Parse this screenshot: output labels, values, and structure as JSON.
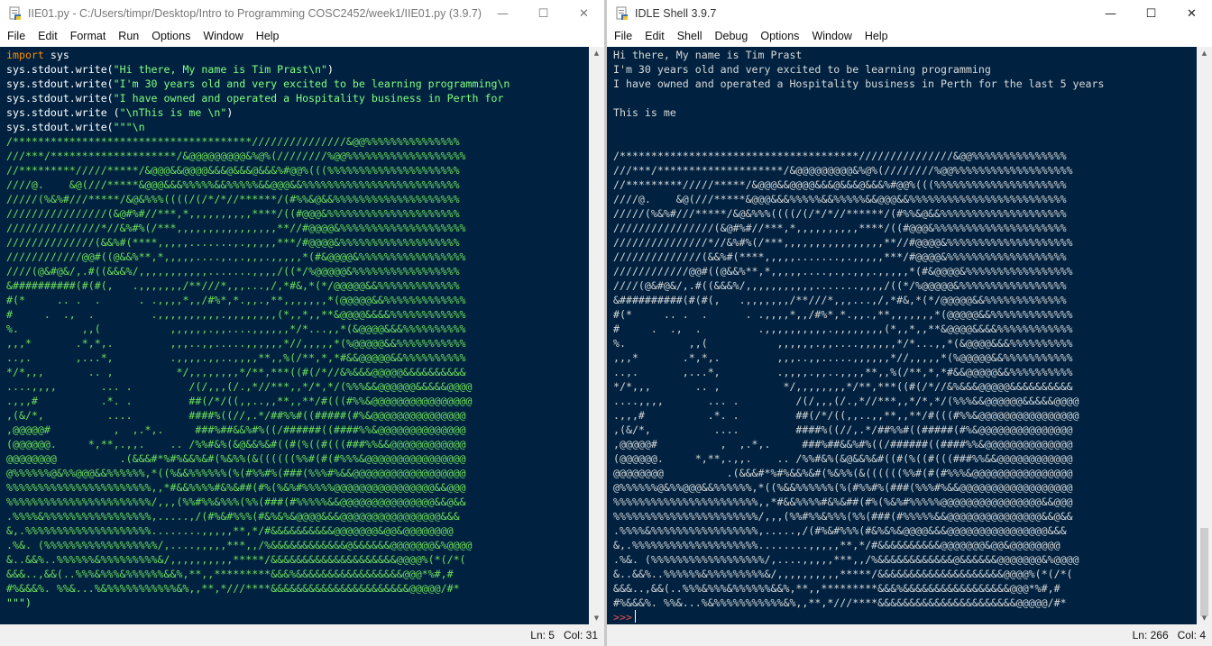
{
  "editor": {
    "title": "IIE01.py - C:/Users/timpr/Desktop/Intro to Programming COSC2452/week1/IIE01.py (3.9.7)",
    "menu": [
      "File",
      "Edit",
      "Format",
      "Run",
      "Options",
      "Window",
      "Help"
    ],
    "code": [
      {
        "kw": "import",
        "rest": " sys"
      },
      {
        "plain": "sys.stdout.write(",
        "str": "\"Hi there, My name is Tim Prast\\n\"",
        "end": ")"
      },
      {
        "plain": "sys.stdout.write(",
        "str": "\"I'm 30 years old and very excited to be learning programming\\n",
        "end": ""
      },
      {
        "plain": "sys.stdout.write(",
        "str": "\"I have owned and operated a Hospitality business in Perth for",
        "end": ""
      },
      {
        "plain": "sys.stdout.write (",
        "str": "\"\\nThis is me \\n\"",
        "end": ")"
      },
      {
        "plain": "sys.stdout.write(",
        "str": "\"\"\"\\n",
        "end": ""
      }
    ],
    "art": [
      "/**************************************///////////////&@@%%%%%%%%%%%%%%%",
      "///***/********************/&@@@@@@@@@&%@%(////////%@@%%%%%%%%%%%%%%%%%%%",
      "//*********/////*****/&@@@&&@@@@&&&@&&&@&&&%#@@%(((%%%%%%%%%%%%%%%%%%%%%",
      "////@.    &@(///*****&@@@&&&%%%%%&&%%%%%&&@@@&&%%%%%%%%%%%%%%%%%%%%%%%%%",
      "/////(%&%#///*****/&@&%%%((((/(/*/*//******/(#%%&@&&%%%%%%%%%%%%%%%%%%%%",
      "////////////////(&@#%#//***,*,,,,,,,,,,****/((#@@@&%%%%%%%%%%%%%%%%%%%%%",
      "///////////////*//&%#%(/***,,,,,,,,,,,,,,,,**//#@@@@&%%%%%%%%%%%%%%%%%%%%",
      "//////////////(&&%#(****,,,,,.......,.,,,,,***/#@@@@&%%%%%%%%%%%%%%%%%%%",
      "////////////@@#((@&&%**,*,,,,,....,.,.,,,.,,,,,*(#&@@@@&%%%%%%%%%%%%%%%%%",
      "////(@&#@&/,.#((&&&%/,,,,,,,,,,,.......,,,,/((*/%@@@@@&%%%%%%%%%%%%%%%%%",
      "&##########(#(#(,   .,,,,,,,/**///*,,,...,/,*#&,*(*/@@@@@&&%%%%%%%%%%%%%",
      "#(*     .. .  .      . .,,,,*,,/#%*,*.,,.,**,,,,,,,*(@@@@@&&%%%%%%%%%%%%%",
      "#     .  .,  .         .,,,,,,,,,,.,,,,,,,,(*,,*,,**&@@@@&&&&%%%%%%%%%%%%",
      "%.          ,,(           ,,,,,,.,,....,,,,,,*/*...,,*(&@@@@&&&%%%%%%%%%%",
      ",,,*       .*,*,.         ,,,..,,.....,,,,,,*//,,,,,*(%@@@@@&&%%%%%%%%%%%",
      "..,.       ,...*,         .,,,,.,,..,,,,**,,%(/**,*,*#&&@@@@@&&%%%%%%%%%%",
      "*/*,,,       .. ,          */,,,,,,,,*/**,***((#(/*//&%&&&@@@@@&&&&&&&&&&",
      "....,,,,       ... .         /(/,,,(/.,*//***,,*/*,*/(%%%&&@@@@@@&&&&&@@@@",
      ".,,,#          .*. .         ##(/*/((,,..,,**,,**/#(((#%%&@@@@@@@@@@@@@@@@",
      ",(&/*,          ....         ####%((//,.*/##%%#((#####(#%&@@@@@@@@@@@@@@@",
      ",@@@@@#          ,  ,.*,.     ###%##&&%#%((/######((####%%&@@@@@@@@@@@@@@",
      "(@@@@@@.     *,**,.,,.    .. /%%#&%(&@&&%&#((#(%((#(((###%%&&@@@@@@@@@@@@",
      "@@@@@@@@          .(&&&#*%#%&&%&#(%&%%(&((((((%%#(#(#%%%&@@@@@@@@@@@@@@@@",
      "@%%%%%%@&%%@@@&&%%%%%%,*((%&&%%%%%%(%(#%%#%(###(%%%#%&&@@@@@@@@@@@@@@@@@@",
      "%%%%%%%%%%%%%%%%%%%%%%%,,*#&&%%%%#&%&##(#%(%&%#%%%%%@@@@@@@@@@@@@@@@&&@@@",
      "%%%%%%%%%%%%%%%%%%%%%%%/,,,(%%#%%&%%%(%%(###(#%%%%%&&@@@@@@@@@@@@@@@&&@&&",
      ".%%%%&%%%%%%%%%%%%%%%%%,.....,/(#%&#%%%(#&%&%&@@@@&&&@@@@@@@@@@@@@@@@&&&",
      "&,.%%%%%%%%%%%%%%%%%%%%........,,,,,**,*/#&&&&&&&&&&@@@@@@@&@@&@@@@@@@@",
      ".%&. (%%%%%%%%%%%%%%%%%%/,....,,,,,***,,/%&&&&&&&&&&&&@&&&&&&@@@@@@@&%@@@@",
      "&..&&%..%%%%%%&%%%%%%%%%&/,,,,,,,,,,*****/&&&&&&&&&&&&&&&&&&&&@@@@%(*(/*(",
      "&&&..,&&(..%%%&%%%&%%%%%%&&%,**,,*********&&&%&&&&&&&&&&&&&&&&&@@@*%#,#",
      "#%&&&%. %%&...%&%%%%%%%%%%%&%,,**,*///****&&&&&&&&&&&&&&&&&&&&&&@@@@@/#*"
    ],
    "closing": "\"\"\")",
    "status": {
      "ln": "Ln: 5",
      "col": "Col: 31"
    }
  },
  "shell": {
    "title": "IDLE Shell 3.9.7",
    "menu": [
      "File",
      "Edit",
      "Shell",
      "Debug",
      "Options",
      "Window",
      "Help"
    ],
    "output": [
      "Hi there, My name is Tim Prast",
      "I'm 30 years old and very excited to be learning programming",
      "I have owned and operated a Hospitality business in Perth for the last 5 years",
      "",
      "This is me",
      "",
      ""
    ],
    "art": [
      "/**************************************///////////////&@@%%%%%%%%%%%%%%%",
      "///***/********************/&@@@@@@@@@&%@%(////////%@@%%%%%%%%%%%%%%%%%%%",
      "//*********/////*****/&@@@&&@@@@&&&@&&&@&&&%#@@%(((%%%%%%%%%%%%%%%%%%%%%",
      "////@.    &@(///*****&@@@&&&%%%%%&&%%%%%&&@@@&&%%%%%%%%%%%%%%%%%%%%%%%%%",
      "/////(%&%#///*****/&@&%%%((((/(/*/*//******/(#%%&@&&%%%%%%%%%%%%%%%%%%%%",
      "////////////////(&@#%#//***,*,,,,,,,,,,****/((#@@@&%%%%%%%%%%%%%%%%%%%%%",
      "///////////////*//&%#%(/***,,,,,,,,,,,,,,,,**//#@@@@&%%%%%%%%%%%%%%%%%%%%",
      "//////////////(&&%#(****,,,,,.......,.,,,,,***/#@@@@&%%%%%%%%%%%%%%%%%%%",
      "////////////@@#((@&&%**,*,,,,,....,.,.,,,.,,,,,*(#&@@@@&%%%%%%%%%%%%%%%%%",
      "////(@&#@&/,.#((&&&%/,,,,,,,,,,,.......,,,,/((*/%@@@@@&%%%%%%%%%%%%%%%%%",
      "&##########(#(#(,   .,,,,,,,/**///*,,,...,/,*#&,*(*/@@@@@&&%%%%%%%%%%%%%",
      "#(*     .. .  .      . .,,,,*,,/#%*,*.,,.,**,,,,,,,*(@@@@@&&%%%%%%%%%%%%%",
      "#     .  .,  .         .,,,,,,,,,,.,,,,,,,,(*,,*,,**&@@@@&&&&%%%%%%%%%%%%",
      "%.          ,,(           ,,,,,,.,,....,,,,,,*/*...,,*(&@@@@&&&%%%%%%%%%%",
      ",,,*       .*,*,.         ,,,..,,.....,,,,,,*//,,,,,*(%@@@@@&&%%%%%%%%%%%",
      "..,.       ,...*,         .,,,,.,,..,,,,**,,%(/**,*,*#&&@@@@@&&%%%%%%%%%%",
      "*/*,,,       .. ,          */,,,,,,,,*/**,***((#(/*//&%&&&@@@@@&&&&&&&&&&",
      "....,,,,       ... .         /(/,,,(/.,*//***,,*/*,*/(%%%&&@@@@@@&&&&&@@@@",
      ".,,,#          .*. .         ##(/*/((,,..,,**,,**/#(((#%%&@@@@@@@@@@@@@@@@",
      ",(&/*,          ....         ####%((//,.*/##%%#((#####(#%&@@@@@@@@@@@@@@@",
      ",@@@@@#          ,  ,.*,.     ###%##&&%#%((/######((####%%&@@@@@@@@@@@@@@",
      "(@@@@@@.     *,**,.,,.    .. /%%#&%(&@&&%&#((#(%((#(((###%%&&@@@@@@@@@@@@",
      "@@@@@@@@          .(&&&#*%#%&&%&#(%&%%(&((((((%%#(#(#%%%&@@@@@@@@@@@@@@@@",
      "@%%%%%%@&%%@@@&&%%%%%%,*((%&&%%%%%%(%(#%%#%(###(%%%#%&&@@@@@@@@@@@@@@@@@@",
      "%%%%%%%%%%%%%%%%%%%%%%%,,*#&&%%%%#&%&##(#%(%&%#%%%%%@@@@@@@@@@@@@@@@&&@@@",
      "%%%%%%%%%%%%%%%%%%%%%%%/,,,(%%#%%&%%%(%%(###(#%%%%%&&@@@@@@@@@@@@@@@&&@&&",
      ".%%%%&%%%%%%%%%%%%%%%%%,.....,/(#%&#%%%(#&%&%&@@@@&&&@@@@@@@@@@@@@@@@&&&",
      "&,.%%%%%%%%%%%%%%%%%%%%........,,,,,**,*/#&&&&&&&&&&@@@@@@@&@@&@@@@@@@@",
      ".%&. (%%%%%%%%%%%%%%%%%%/,....,,,,,***,,/%&&&&&&&&&&&&@&&&&&&@@@@@@@&%@@@@",
      "&..&&%..%%%%%%&%%%%%%%%%&/,,,,,,,,,,*****/&&&&&&&&&&&&&&&&&&&&@@@@%(*(/*(",
      "&&&..,&&(..%%%&%%%&%%%%%%&&%,**,,*********&&&%&&&&&&&&&&&&&&&&&@@@*%#,#",
      "#%&&&%. %%&...%&%%%%%%%%%%%&%,,**,*///****&&&&&&&&&&&&&&&&&&&&&&@@@@@/#*"
    ],
    "prompt": ">>>",
    "status": {
      "ln": "Ln: 266",
      "col": "Col: 4"
    }
  },
  "icons": {
    "minimize": "minimize-icon",
    "maximize": "maximize-icon",
    "close": "close-icon"
  }
}
